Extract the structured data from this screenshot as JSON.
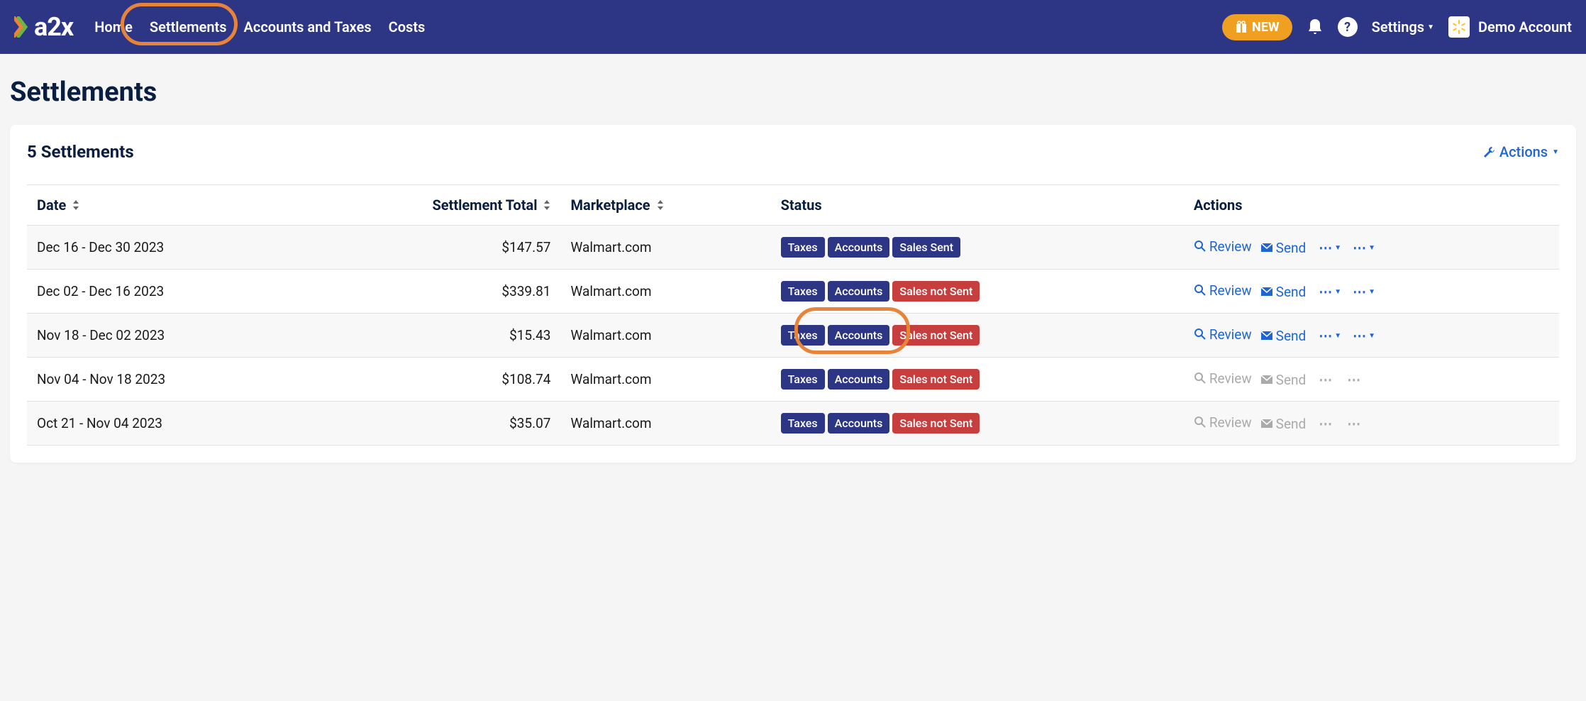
{
  "nav": {
    "home": "Home",
    "settlements": "Settlements",
    "accounts_taxes": "Accounts and Taxes",
    "costs": "Costs",
    "new_badge": "NEW",
    "settings": "Settings",
    "account_name": "Demo Account"
  },
  "page": {
    "title": "Settlements",
    "count_label": "5 Settlements",
    "actions_label": "Actions"
  },
  "table": {
    "headers": {
      "date": "Date",
      "total": "Settlement Total",
      "marketplace": "Marketplace",
      "status": "Status",
      "actions": "Actions"
    },
    "action_labels": {
      "review": "Review",
      "send": "Send"
    },
    "rows": [
      {
        "date": "Dec 16 - Dec 30 2023",
        "total": "$147.57",
        "marketplace": "Walmart.com",
        "badges": [
          {
            "text": "Taxes",
            "color": "blue"
          },
          {
            "text": "Accounts",
            "color": "blue"
          },
          {
            "text": "Sales Sent",
            "color": "blue"
          }
        ],
        "active": true
      },
      {
        "date": "Dec 02 - Dec 16 2023",
        "total": "$339.81",
        "marketplace": "Walmart.com",
        "badges": [
          {
            "text": "Taxes",
            "color": "blue"
          },
          {
            "text": "Accounts",
            "color": "blue"
          },
          {
            "text": "Sales not Sent",
            "color": "red"
          }
        ],
        "active": true
      },
      {
        "date": "Nov 18 - Dec 02 2023",
        "total": "$15.43",
        "marketplace": "Walmart.com",
        "badges": [
          {
            "text": "Taxes",
            "color": "blue"
          },
          {
            "text": "Accounts",
            "color": "blue"
          },
          {
            "text": "Sales not Sent",
            "color": "red"
          }
        ],
        "active": true
      },
      {
        "date": "Nov 04 - Nov 18 2023",
        "total": "$108.74",
        "marketplace": "Walmart.com",
        "badges": [
          {
            "text": "Taxes",
            "color": "blue"
          },
          {
            "text": "Accounts",
            "color": "blue"
          },
          {
            "text": "Sales not Sent",
            "color": "red"
          }
        ],
        "active": false
      },
      {
        "date": "Oct 21 - Nov 04 2023",
        "total": "$35.07",
        "marketplace": "Walmart.com",
        "badges": [
          {
            "text": "Taxes",
            "color": "blue"
          },
          {
            "text": "Accounts",
            "color": "blue"
          },
          {
            "text": "Sales not Sent",
            "color": "red"
          }
        ],
        "active": false
      }
    ]
  }
}
